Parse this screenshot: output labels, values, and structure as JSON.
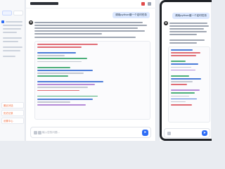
{
  "sidebar": {
    "bottom_items": [
      {
        "label": "最近对话"
      },
      {
        "label": "历史记录"
      },
      {
        "label": "设置中心"
      }
    ]
  },
  "chat": {
    "user_message": "请用python做一个定时任务",
    "assistant_avatar": "✪",
    "composer_placeholder": "输入您的问题...",
    "send_icon": "send-icon"
  },
  "phone": {
    "user_message": "请用python做一个定时任务"
  },
  "colors": {
    "accent": "#2d6cf6",
    "user_bubble": "#dce8ff"
  }
}
